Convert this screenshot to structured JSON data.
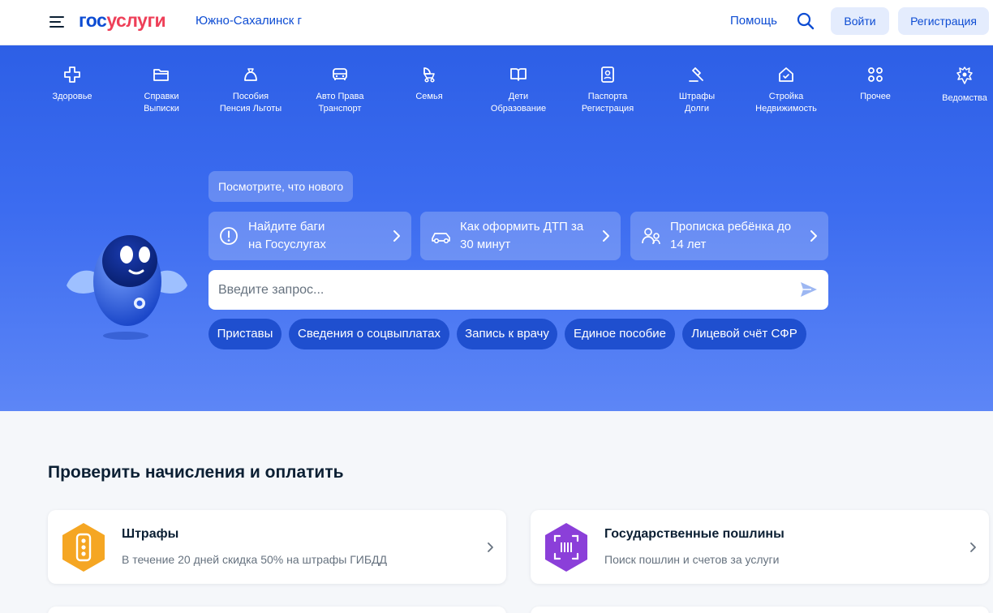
{
  "header": {
    "logo_part1": "гос",
    "logo_part2": "услуги",
    "city": "Южно-Сахалинск г",
    "help_label": "Помощь",
    "login_label": "Войти",
    "register_label": "Регистрация"
  },
  "categories": [
    {
      "label": "Здоровье",
      "icon": "health-icon"
    },
    {
      "label": "Справки\nВыписки",
      "icon": "folder-icon"
    },
    {
      "label": "Пособия\nПенсия Льготы",
      "icon": "coin-bag-icon"
    },
    {
      "label": "Авто Права\nТранспорт",
      "icon": "car-icon"
    },
    {
      "label": "Семья",
      "icon": "stroller-icon"
    },
    {
      "label": "Дети\nОбразование",
      "icon": "book-icon"
    },
    {
      "label": "Паспорта\nРегистрация",
      "icon": "passport-icon"
    },
    {
      "label": "Штрафы\nДолги",
      "icon": "gavel-icon"
    },
    {
      "label": "Стройка\nНедвижимость",
      "icon": "house-icon"
    },
    {
      "label": "Прочее",
      "icon": "grid-icon"
    },
    {
      "label": "Ведомства",
      "icon": "coat-of-arms-icon"
    }
  ],
  "hero": {
    "whats_new": "Посмотрите, что нового",
    "cards": [
      {
        "text": "Найдите баги\nна Госуслугах",
        "icon": "info-icon"
      },
      {
        "text": "Как оформить ДТП за\n30 минут",
        "icon": "car-icon"
      },
      {
        "text": "Прописка ребёнка до\n14 лет",
        "icon": "family-icon"
      }
    ],
    "search_placeholder": "Введите запрос...",
    "chips": [
      "Приставы",
      "Сведения о соцвыплатах",
      "Запись к врачу",
      "Единое пособие",
      "Лицевой счёт СФР"
    ]
  },
  "payments": {
    "title": "Проверить начисления и оплатить",
    "cards": [
      {
        "title": "Штрафы",
        "subtitle": "В течение 20 дней скидка 50% на штрафы ГИБДД",
        "icon": "traffic-light-icon",
        "color": "#f5a623"
      },
      {
        "title": "Государственные пошлины",
        "subtitle": "Поиск пошлин и счетов за услуги",
        "icon": "scan-code-icon",
        "color": "#8b3fd9"
      }
    ]
  },
  "colors": {
    "brand_blue": "#0d4cd3",
    "brand_red": "#ee3f58",
    "hero_top": "#2d5fe6",
    "hero_bottom": "#5d86f6"
  }
}
